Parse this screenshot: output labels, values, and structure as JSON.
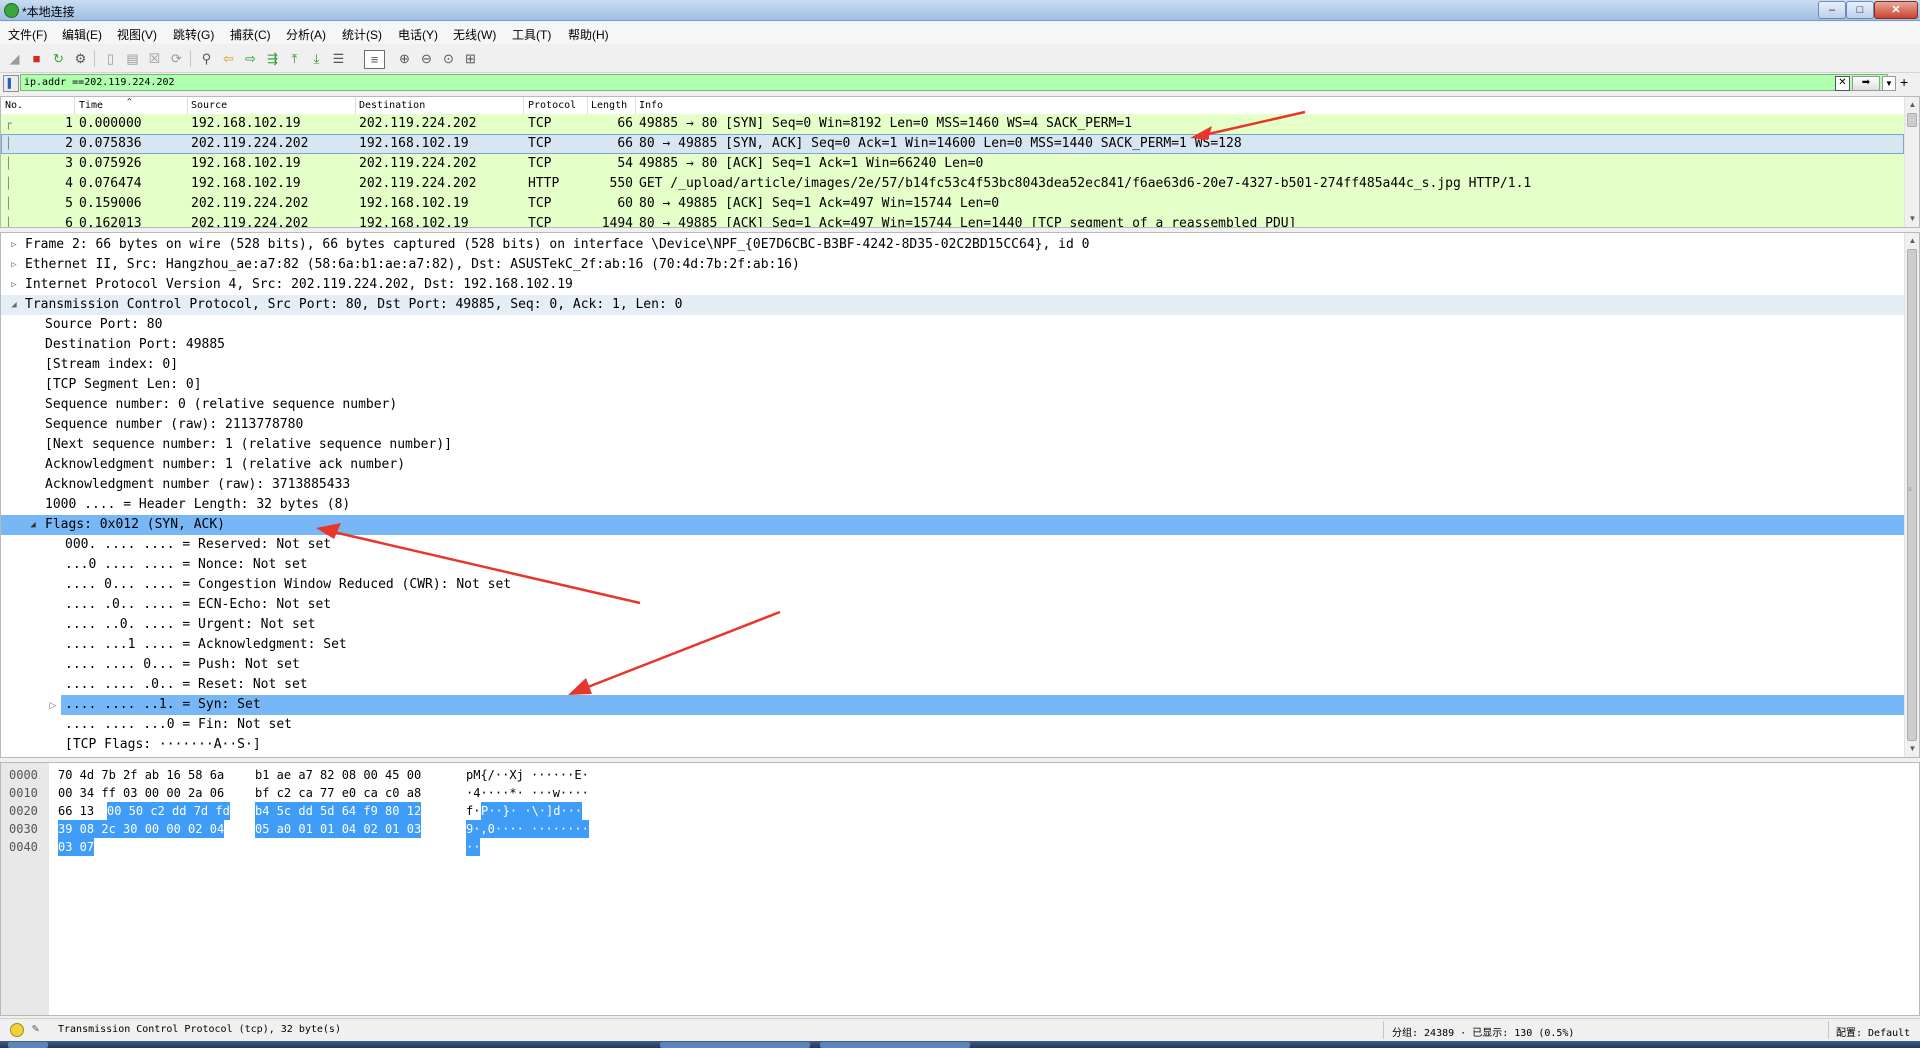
{
  "window": {
    "title": "*本地连接",
    "minimize_glyph": "–",
    "maximize_glyph": "□",
    "close_glyph": "✕"
  },
  "menu": [
    "文件(F)",
    "编辑(E)",
    "视图(V)",
    "跳转(G)",
    "捕获(C)",
    "分析(A)",
    "统计(S)",
    "电话(Y)",
    "无线(W)",
    "工具(T)",
    "帮助(H)"
  ],
  "toolbar": {
    "icons": [
      "shark-fin-start-icon",
      "stop-capture-icon",
      "restart-capture-icon",
      "capture-options-icon",
      "open-file-icon",
      "save-file-icon",
      "close-file-icon",
      "reload-icon",
      "find-icon",
      "go-back-icon",
      "go-forward-icon",
      "go-to-packet-icon",
      "go-first-icon",
      "go-last-icon",
      "auto-scroll-icon",
      "colorize-icon",
      "zoom-in-icon",
      "zoom-out-icon",
      "zoom-normal-icon",
      "resize-columns-icon"
    ]
  },
  "filter": {
    "value": "ip.addr ==202.119.224.202",
    "filter_color": "#afffaf",
    "clear_glyph": "✕",
    "apply_glyph": "➡",
    "dropdown_glyph": "▼",
    "add_glyph": "+"
  },
  "packet_list": {
    "columns": [
      "No.",
      "Time",
      "Source",
      "Destination",
      "Protocol",
      "Length",
      "Info"
    ],
    "rows": [
      {
        "no": "1",
        "time": "0.000000",
        "src": "192.168.102.19",
        "dst": "202.119.224.202",
        "proto": "TCP",
        "len": "66",
        "info": "49885 → 80 [SYN] Seq=0 Win=8192 Len=0 MSS=1460 WS=4 SACK_PERM=1"
      },
      {
        "no": "2",
        "time": "0.075836",
        "src": "202.119.224.202",
        "dst": "192.168.102.19",
        "proto": "TCP",
        "len": "66",
        "info": "80 → 49885 [SYN, ACK] Seq=0 Ack=1 Win=14600 Len=0 MSS=1440 SACK_PERM=1 WS=128"
      },
      {
        "no": "3",
        "time": "0.075926",
        "src": "192.168.102.19",
        "dst": "202.119.224.202",
        "proto": "TCP",
        "len": "54",
        "info": "49885 → 80 [ACK] Seq=1 Ack=1 Win=66240 Len=0"
      },
      {
        "no": "4",
        "time": "0.076474",
        "src": "192.168.102.19",
        "dst": "202.119.224.202",
        "proto": "HTTP",
        "len": "550",
        "info": "GET /_upload/article/images/2e/57/b14fc53c4f53bc8043dea52ec841/f6ae63d6-20e7-4327-b501-274ff485a44c_s.jpg HTTP/1.1"
      },
      {
        "no": "5",
        "time": "0.159006",
        "src": "202.119.224.202",
        "dst": "192.168.102.19",
        "proto": "TCP",
        "len": "60",
        "info": "80 → 49885 [ACK] Seq=1 Ack=497 Win=15744 Len=0"
      },
      {
        "no": "6",
        "time": "0.162013",
        "src": "202.119.224.202",
        "dst": "192.168.102.19",
        "proto": "TCP",
        "len": "1494",
        "info": "80 → 49885 [ACK] Seq=1 Ack=497 Win=15744 Len=1440 [TCP segment of a reassembled PDU]"
      }
    ],
    "row_color": "#e4ffc7",
    "selected_color": "#d7e6f3"
  },
  "details": {
    "rows": [
      {
        "text": "Frame 2: 66 bytes on wire (528 bits), 66 bytes captured (528 bits) on interface \\Device\\NPF_{0E7D6CBC-B3BF-4242-8D35-02C2BD15CC64}, id 0",
        "toggle": "▷"
      },
      {
        "text": "Ethernet II, Src: Hangzhou_ae:a7:82 (58:6a:b1:ae:a7:82), Dst: ASUSTekC_2f:ab:16 (70:4d:7b:2f:ab:16)",
        "toggle": "▷"
      },
      {
        "text": "Internet Protocol Version 4, Src: 202.119.224.202, Dst: 192.168.102.19",
        "toggle": "▷"
      },
      {
        "text": "Transmission Control Protocol, Src Port: 80, Dst Port: 49885, Seq: 0, Ack: 1, Len: 0",
        "toggle": "◢"
      },
      {
        "text": "Source Port: 80"
      },
      {
        "text": "Destination Port: 49885"
      },
      {
        "text": "[Stream index: 0]"
      },
      {
        "text": "[TCP Segment Len: 0]"
      },
      {
        "text": "Sequence number: 0    (relative sequence number)"
      },
      {
        "text": "Sequence number (raw): 2113778780"
      },
      {
        "text": "[Next sequence number: 1    (relative sequence number)]"
      },
      {
        "text": "Acknowledgment number: 1    (relative ack number)"
      },
      {
        "text": "Acknowledgment number (raw): 3713885433"
      },
      {
        "text": "1000 .... = Header Length: 32 bytes (8)"
      },
      {
        "text": "Flags: 0x012 (SYN, ACK)",
        "toggle": "◢"
      },
      {
        "text": "000. .... .... = Reserved: Not set"
      },
      {
        "text": "...0 .... .... = Nonce: Not set"
      },
      {
        "text": ".... 0... .... = Congestion Window Reduced (CWR): Not set"
      },
      {
        "text": ".... .0.. .... = ECN-Echo: Not set"
      },
      {
        "text": ".... ..0. .... = Urgent: Not set"
      },
      {
        "text": ".... ...1 .... = Acknowledgment: Set"
      },
      {
        "text": ".... .... 0... = Push: Not set"
      },
      {
        "text": ".... .... .0.. = Reset: Not set"
      },
      {
        "text": ".... .... ..1. = Syn: Set",
        "toggle": "▷"
      },
      {
        "text": ".... .... ...0 = Fin: Not set"
      },
      {
        "text": "[TCP Flags: ·······A··S·]"
      }
    ],
    "highlight_color": "#78b7f5"
  },
  "bytes": {
    "rows": [
      {
        "offset": "0000",
        "hex_plain_a": "70 4d 7b 2f ab 16 58 6a",
        "hex_plain_b": "b1 ae a7 82 08 00 45 00",
        "ascii_plain": "pM{/··Xj ······E·"
      },
      {
        "offset": "0010",
        "hex_plain_a": "00 34 ff 03 00 00 2a 06",
        "hex_plain_b": "bf c2 ca 77 e0 ca c0 a8",
        "ascii_plain": "·4····*· ···w····"
      },
      {
        "offset": "0020",
        "hex_plain_a": "66 13",
        "hex_hl_a": "00 50 c2 dd 7d fd",
        "hex_hl_b": "b4 5c dd 5d 64 f9 80 12",
        "ascii_plain": "f·",
        "ascii_hl": "P··}· ·\\·]d···"
      },
      {
        "offset": "0030",
        "hex_hl_a": "39 08 2c 30 00 00 02 04",
        "hex_hl_b": "05 a0 01 01 04 02 01 03",
        "ascii_hl": "9·,0···· ········"
      },
      {
        "offset": "0040",
        "hex_hl_a": "03 07",
        "ascii_hl": "··"
      }
    ],
    "highlight_color": "#3f9cf7"
  },
  "status": {
    "left": "Transmission Control Protocol (tcp), 32 byte(s)",
    "middle": "分组: 24389 · 已显示: 130 (0.5%)",
    "right": "配置: Default"
  },
  "annotations": {
    "arrow_color": "#e8362b"
  }
}
